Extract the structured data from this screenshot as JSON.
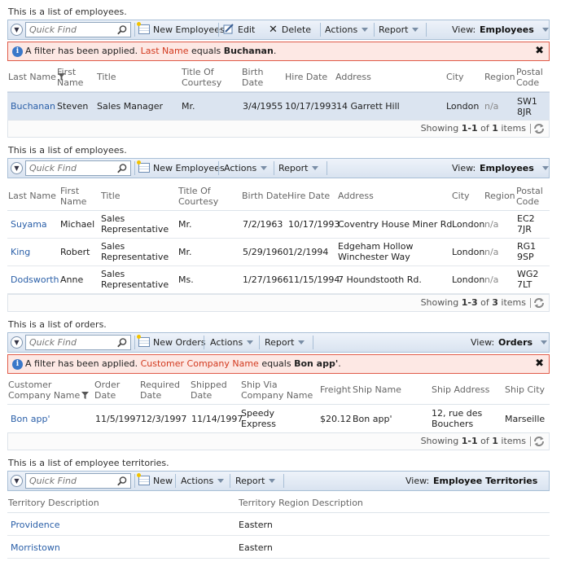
{
  "common": {
    "quick_find_placeholder": "Quick Find",
    "view_label": "View:",
    "actions_label": "Actions",
    "report_label": "Report",
    "filter_applied_prefix": "A filter has been applied.",
    "equals_word": "equals"
  },
  "employees1": {
    "description": "This is a list of employees.",
    "toolbar": {
      "new_label": "New Employees",
      "edit_label": "Edit",
      "delete_label": "Delete",
      "view_value": "Employees"
    },
    "filter": {
      "field": "Last Name",
      "value": "Buchanan"
    },
    "columns": [
      "Last Name",
      "First Name",
      "Title",
      "Title Of Courtesy",
      "Birth Date",
      "Hire Date",
      "Address",
      "City",
      "Region",
      "Postal Code"
    ],
    "rows": [
      {
        "last_name": "Buchanan",
        "first_name": "Steven",
        "title": "Sales Manager",
        "courtesy": "Mr.",
        "birth": "3/4/1955",
        "hire": "10/17/1993",
        "address": "14 Garrett Hill",
        "city": "London",
        "region": "n/a",
        "postal": "SW1 8JR"
      }
    ],
    "pager": {
      "showing": "Showing",
      "range": "1-1",
      "of": "of",
      "total": "1",
      "items": "items"
    }
  },
  "employees2": {
    "description": "This is a list of employees.",
    "toolbar": {
      "new_label": "New Employees",
      "view_value": "Employees"
    },
    "columns": [
      "Last Name",
      "First Name",
      "Title",
      "Title Of Courtesy",
      "Birth Date",
      "Hire Date",
      "Address",
      "City",
      "Region",
      "Postal Code"
    ],
    "rows": [
      {
        "last_name": "Suyama",
        "first_name": "Michael",
        "title": "Sales Representative",
        "courtesy": "Mr.",
        "birth": "7/2/1963",
        "hire": "10/17/1993",
        "address": "Coventry House Miner Rd.",
        "city": "London",
        "region": "n/a",
        "postal": "EC2 7JR"
      },
      {
        "last_name": "King",
        "first_name": "Robert",
        "title": "Sales Representative",
        "courtesy": "Mr.",
        "birth": "5/29/1960",
        "hire": "1/2/1994",
        "address": "Edgeham Hollow Winchester Way",
        "city": "London",
        "region": "n/a",
        "postal": "RG1 9SP"
      },
      {
        "last_name": "Dodsworth",
        "first_name": "Anne",
        "title": "Sales Representative",
        "courtesy": "Ms.",
        "birth": "1/27/1966",
        "hire": "11/15/1994",
        "address": "7 Houndstooth Rd.",
        "city": "London",
        "region": "n/a",
        "postal": "WG2 7LT"
      }
    ],
    "pager": {
      "showing": "Showing",
      "range": "1-3",
      "of": "of",
      "total": "3",
      "items": "items"
    }
  },
  "orders": {
    "description": "This is a list of orders.",
    "toolbar": {
      "new_label": "New Orders",
      "view_value": "Orders"
    },
    "filter": {
      "field": "Customer Company Name",
      "value": "Bon app'"
    },
    "columns": [
      "Customer Company Name",
      "Order Date",
      "Required Date",
      "Shipped Date",
      "Ship Via Company Name",
      "Freight",
      "Ship Name",
      "Ship Address",
      "Ship City"
    ],
    "rows": [
      {
        "customer": "Bon app'",
        "order": "11/5/1997",
        "required": "12/3/1997",
        "shipped": "11/14/1997",
        "ship_via": "Speedy Express",
        "freight": "$20.12",
        "ship_name": "Bon app'",
        "ship_address": "12, rue des Bouchers",
        "ship_city": "Marseille"
      }
    ],
    "pager": {
      "showing": "Showing",
      "range": "1-1",
      "of": "of",
      "total": "1",
      "items": "items"
    }
  },
  "territories": {
    "description": "This is a list of employee territories.",
    "toolbar": {
      "new_label": "New",
      "view_value": "Employee Territories"
    },
    "columns": [
      "Territory Description",
      "Territory Region Description"
    ],
    "rows": [
      {
        "territory": "Providence",
        "region": "Eastern"
      },
      {
        "territory": "Morristown",
        "region": "Eastern"
      }
    ]
  }
}
